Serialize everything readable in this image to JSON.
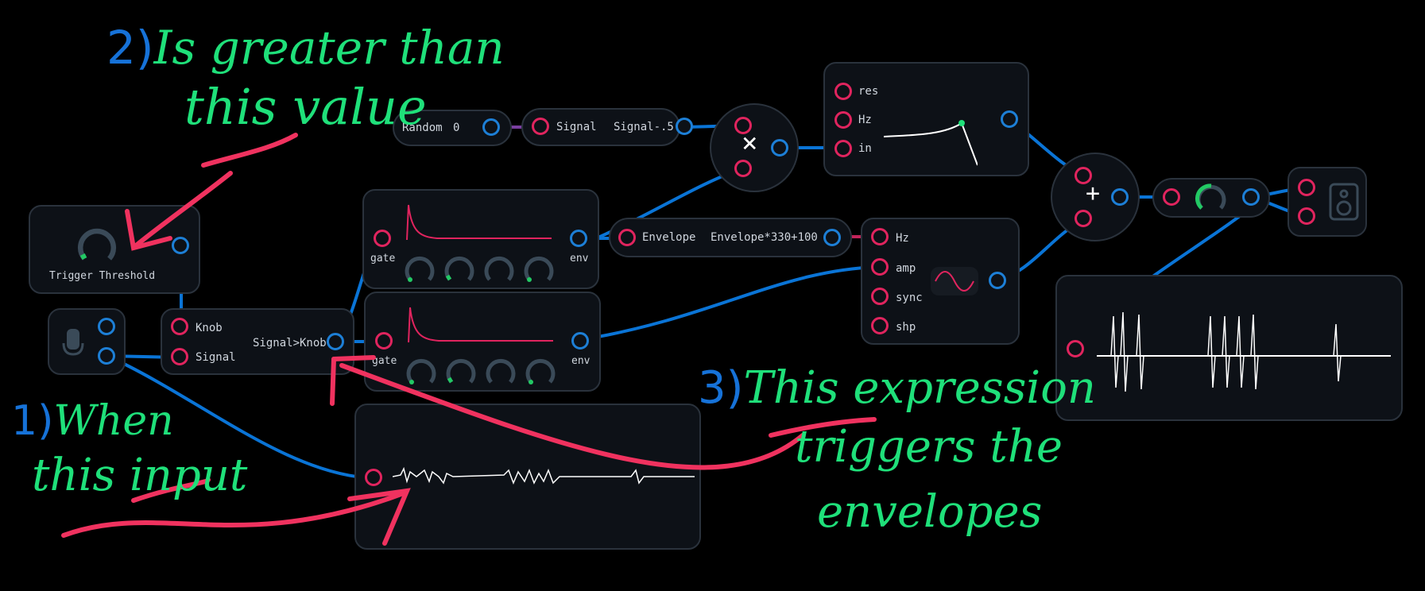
{
  "colors": {
    "background": "#000000",
    "node": "#0d1117",
    "node_border": "#2a323c",
    "input_port": "#e0245e",
    "output_port": "#1d7fd6",
    "wire": "#0a74d6",
    "annotation_green": "#1fe07a",
    "annotation_blue": "#1672d8",
    "annotation_red": "#f0325f"
  },
  "nodes": {
    "random": {
      "label": "Random",
      "value": "0"
    },
    "signal_expr": {
      "input": "Signal",
      "output": "Signal-.5"
    },
    "multiply": {
      "symbol": "×"
    },
    "filter": {
      "ports": [
        "res",
        "Hz",
        "in"
      ]
    },
    "add": {
      "symbol": "+"
    },
    "trigger_threshold": {
      "label": "Trigger Threshold"
    },
    "mic": {
      "icon": "microphone-icon"
    },
    "comparator": {
      "inputs": [
        "Knob",
        "Signal"
      ],
      "output": "Signal>Knob"
    },
    "envelope1": {
      "input": "gate",
      "output": "env"
    },
    "envelope2": {
      "input": "gate",
      "output": "env"
    },
    "envelope_expr": {
      "input": "Envelope",
      "output": "Envelope*330+100"
    },
    "oscillator": {
      "ports": [
        "Hz",
        "amp",
        "sync",
        "shp"
      ],
      "icon": "sine-wave-icon"
    },
    "volume": {
      "icon": "volume-knob-icon"
    },
    "speaker": {
      "icon": "speaker-icon"
    }
  },
  "annotations": {
    "note1": {
      "number": "1)",
      "line1": "When",
      "line2": "this input"
    },
    "note2": {
      "number": "2)",
      "line1": "Is greater than",
      "line2": "this value"
    },
    "note3": {
      "number": "3)",
      "line1": "This expression",
      "line2": "triggers the",
      "line3": "envelopes"
    }
  }
}
